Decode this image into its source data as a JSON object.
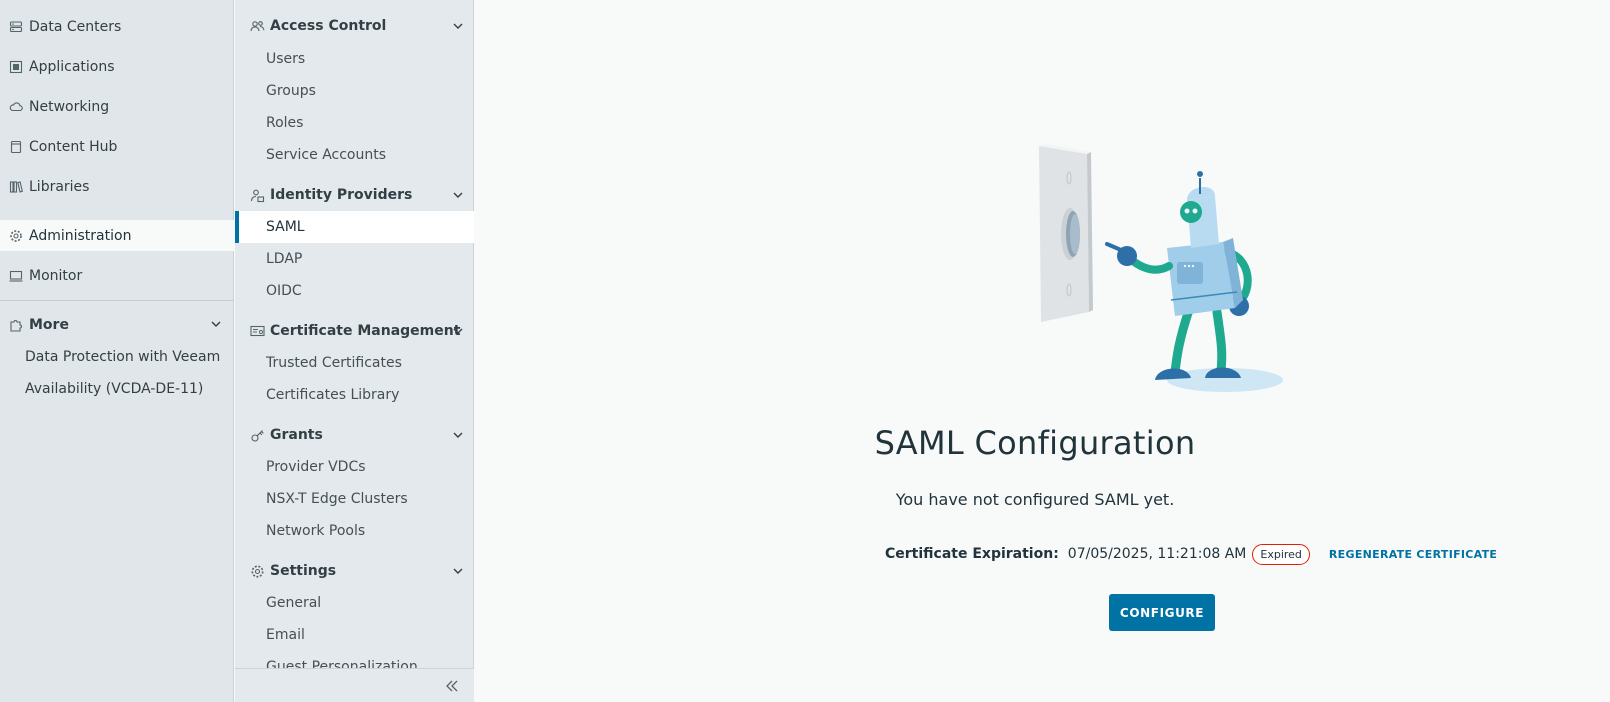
{
  "leftnav": {
    "items": [
      {
        "label": "Data Centers",
        "icon": "data-center-icon"
      },
      {
        "label": "Applications",
        "icon": "applications-icon"
      },
      {
        "label": "Networking",
        "icon": "cloud-network-icon"
      },
      {
        "label": "Content Hub",
        "icon": "content-hub-icon"
      },
      {
        "label": "Libraries",
        "icon": "libraries-icon"
      },
      {
        "label": "Administration",
        "icon": "gear-icon",
        "active": true
      },
      {
        "label": "Monitor",
        "icon": "monitor-icon"
      }
    ],
    "more": {
      "label": "More",
      "items": [
        "Data Protection with Veeam",
        "Availability (VCDA-DE-11)"
      ]
    }
  },
  "subnav": {
    "groups": [
      {
        "title": "Access Control",
        "items": [
          "Users",
          "Groups",
          "Roles",
          "Service Accounts"
        ]
      },
      {
        "title": "Identity Providers",
        "items": [
          "SAML",
          "LDAP",
          "OIDC"
        ],
        "active": "SAML"
      },
      {
        "title": "Certificate Management",
        "items": [
          "Trusted Certificates",
          "Certificates Library"
        ]
      },
      {
        "title": "Grants",
        "items": [
          "Provider VDCs",
          "NSX-T Edge Clusters",
          "Network Pools"
        ]
      },
      {
        "title": "Settings",
        "items": [
          "General",
          "Email",
          "Guest Personalization"
        ]
      }
    ]
  },
  "main": {
    "title": "SAML Configuration",
    "subtitle": "You have not configured SAML yet.",
    "cert_label": "Certificate Expiration:",
    "cert_value": "07/05/2025, 11:21:08 AM",
    "badge": "Expired",
    "regenerate_label": "REGENERATE CERTIFICATE",
    "configure_label": "CONFIGURE"
  },
  "colors": {
    "accent": "#0072a3",
    "expired_badge_border": "#e02200",
    "leftnav_bg": "#e0e6ea",
    "content_bg": "#f8fafa"
  }
}
